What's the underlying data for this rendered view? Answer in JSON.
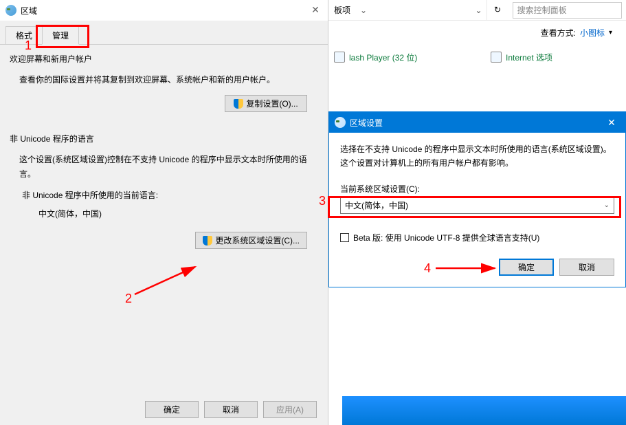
{
  "region_dialog": {
    "title": "区域",
    "tabs": {
      "format": "格式",
      "admin": "管理"
    },
    "welcome": {
      "title": "欢迎屏幕和新用户帐户",
      "desc": "查看你的国际设置并将其复制到欢迎屏幕、系统帐户和新的用户帐户。",
      "btn": "复制设置(O)..."
    },
    "nonunicode": {
      "title": "非 Unicode 程序的语言",
      "desc": "这个设置(系统区域设置)控制在不支持 Unicode 的程序中显示文本时所使用的语言。",
      "sub": "非 Unicode 程序中所使用的当前语言:",
      "current": "中文(简体，中国)",
      "btn": "更改系统区域设置(C)..."
    },
    "footer": {
      "ok": "确定",
      "cancel": "取消",
      "apply": "应用(A)"
    }
  },
  "cp": {
    "crumb": "板项",
    "search_placeholder": "搜索控制面板",
    "view_label": "查看方式:",
    "view_value": "小图标",
    "item_flash": "lash Player (32 位)",
    "item_internet": "Internet 选项"
  },
  "popup": {
    "title": "区域设置",
    "desc": "选择在不支持 Unicode 的程序中显示文本时所使用的语言(系统区域设置)。这个设置对计算机上的所有用户帐户都有影响。",
    "field_label": "当前系统区域设置(C):",
    "selected": "中文(简体，中国)",
    "checkbox_label": "Beta 版: 使用 Unicode UTF-8 提供全球语言支持(U)",
    "ok": "确定",
    "cancel": "取消"
  },
  "anno": {
    "n1": "1",
    "n2": "2",
    "n3": "3",
    "n4": "4"
  }
}
